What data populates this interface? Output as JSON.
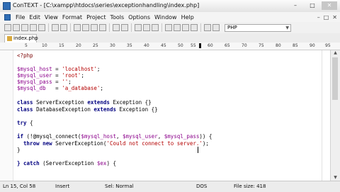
{
  "window": {
    "title": "ConTEXT - [C:\\xampp\\htdocs\\series\\exceptionhandling\\index.php]",
    "controls": [
      "–",
      "□",
      "✕"
    ]
  },
  "menu": [
    "File",
    "Edit",
    "View",
    "Format",
    "Project",
    "Tools",
    "Options",
    "Window",
    "Help"
  ],
  "mdi_controls": [
    "–",
    "□",
    "✕"
  ],
  "toolbar": {
    "language": "PHP"
  },
  "tabs": [
    {
      "label": "index.php"
    }
  ],
  "ruler": {
    "labels": [
      "5",
      "10",
      "15",
      "20",
      "25",
      "30",
      "35",
      "40",
      "45",
      "50",
      "55",
      "60",
      "65",
      "70",
      "75",
      "80",
      "85",
      "90",
      "95"
    ]
  },
  "code": {
    "l1": "<?php",
    "l3v": "$mysql_host",
    "l3r": " = ",
    "l3s": "'localhost'",
    "l3e": ";",
    "l4v": "$mysql_user",
    "l4r": " = ",
    "l4s": "'root'",
    "l4e": ";",
    "l5v": "$mysql_pass",
    "l5r": " = ",
    "l5s": "''",
    "l5e": ";",
    "l6v": "$mysql_db",
    "l6r": "   = ",
    "l6s": "'a_database'",
    "l6e": ";",
    "l8a": "class",
    "l8b": " ServerException ",
    "l8c": "extends",
    "l8d": " Exception",
    "l8e": " {}",
    "l9a": "class",
    "l9b": " DatabaseException ",
    "l9c": "extends",
    "l9d": " Exception",
    "l9e": " {}",
    "l11a": "try",
    "l11b": " {",
    "l13a": "if",
    "l13b": " (!@mysql_connect(",
    "l13c": "$mysql_host",
    "l13d": ", ",
    "l13e": "$mysql_user",
    "l13f": ", ",
    "l13g": "$mysql_pass",
    "l13h": ")) {",
    "l14a": "  throw new",
    "l14b": " ServerException(",
    "l14c": "'Could not connect to server.'",
    "l14d": ");",
    "l15": "}",
    "l17a": "} catch",
    "l17b": " (ServerException ",
    "l17c": "$ex",
    "l17d": ") {"
  },
  "status": {
    "position": "Ln 15, Col 58",
    "mode": "Insert",
    "sel": "Sel: Normal",
    "format": "DOS",
    "filesize": "File size: 418"
  }
}
